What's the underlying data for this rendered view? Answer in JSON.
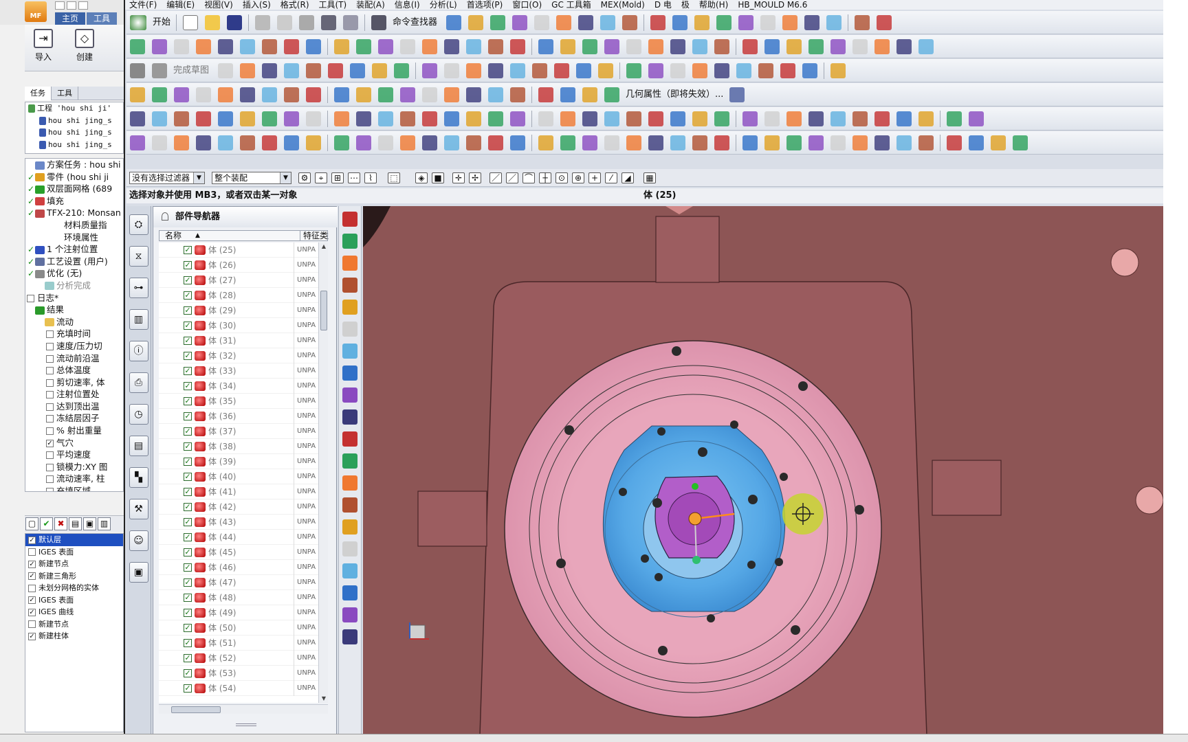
{
  "left_app": {
    "logo": "MF",
    "ribbon_tabs": [
      "主页",
      "工具"
    ],
    "ribbon_buttons": [
      "导入",
      "创建"
    ],
    "pane_tabs": [
      "任务",
      "工具"
    ],
    "project_tree": [
      {
        "label": "工程 'hou shi ji'",
        "level": 0
      },
      {
        "label": "hou shi jing_s",
        "level": 1
      },
      {
        "label": "hou shi jing_s",
        "level": 1
      },
      {
        "label": "hou shi jing_s",
        "level": 1
      }
    ],
    "study_tree": [
      {
        "label": "方案任务 : hou shi",
        "check": "",
        "color": "#6b88c8",
        "indent": 0
      },
      {
        "label": "零件 (hou shi ji",
        "check": "✓",
        "color": "#e0a020",
        "indent": 0
      },
      {
        "label": "双层面网格 (689",
        "check": "✓",
        "color": "#2aa02a",
        "indent": 0
      },
      {
        "label": "填充",
        "check": "✓",
        "color": "#d04040",
        "indent": 0
      },
      {
        "label": "TFX-210: Monsan",
        "check": "✓",
        "color": "#c04848",
        "indent": 0
      },
      {
        "label": "材料质量指",
        "check": "",
        "color": "",
        "indent": 3
      },
      {
        "label": "环境属性",
        "check": "",
        "color": "",
        "indent": 3
      },
      {
        "label": "1 个注射位置",
        "check": "✓",
        "color": "#3050c0",
        "indent": 0
      },
      {
        "label": "工艺设置 (用户)",
        "check": "✓",
        "color": "#6070a0",
        "indent": 0
      },
      {
        "label": "优化 (无)",
        "check": "✓",
        "color": "#8a8a8a",
        "indent": 0
      },
      {
        "label": "分析完成",
        "check": "",
        "color": "#9cc",
        "indent": 1,
        "grey": true
      },
      {
        "label": "日志*",
        "check": "☐",
        "color": "",
        "indent": 0
      },
      {
        "label": "结果",
        "check": "",
        "color": "#2a9a2a",
        "indent": 0
      },
      {
        "label": "流动",
        "check": "",
        "color": "#e8c050",
        "indent": 1
      },
      {
        "label": "充填时间",
        "check": "☐",
        "color": "",
        "indent": 2
      },
      {
        "label": "速度/压力切",
        "check": "☐",
        "color": "",
        "indent": 2
      },
      {
        "label": "流动前沿温",
        "check": "☐",
        "color": "",
        "indent": 2
      },
      {
        "label": "总体温度",
        "check": "☐",
        "color": "",
        "indent": 2
      },
      {
        "label": "剪切速率, 体",
        "check": "☐",
        "color": "",
        "indent": 2
      },
      {
        "label": "注射位置处",
        "check": "☐",
        "color": "",
        "indent": 2
      },
      {
        "label": "达到顶出温",
        "check": "☐",
        "color": "",
        "indent": 2
      },
      {
        "label": "冻结层因子",
        "check": "☐",
        "color": "",
        "indent": 2
      },
      {
        "label": "% 射出重量",
        "check": "☐",
        "color": "",
        "indent": 2
      },
      {
        "label": "气穴",
        "check": "☑",
        "color": "",
        "indent": 2
      },
      {
        "label": "平均速度",
        "check": "☐",
        "color": "",
        "indent": 2
      },
      {
        "label": "锁模力:XY 图",
        "check": "☐",
        "color": "",
        "indent": 2
      },
      {
        "label": "流动速率, 柱",
        "check": "☐",
        "color": "",
        "indent": 2
      },
      {
        "label": "充填区域",
        "check": "☐",
        "color": "",
        "indent": 2
      }
    ],
    "layers": [
      {
        "label": "默认层",
        "checked": true,
        "selected": true
      },
      {
        "label": "IGES 表面",
        "checked": false
      },
      {
        "label": "新建节点",
        "checked": true
      },
      {
        "label": "新建三角形",
        "checked": true
      },
      {
        "label": "未划分网格的实体",
        "checked": false
      },
      {
        "label": "IGES 表面",
        "checked": true
      },
      {
        "label": "IGES 曲线",
        "checked": true
      },
      {
        "label": "新建节点",
        "checked": false
      },
      {
        "label": "新建柱体",
        "checked": true
      }
    ]
  },
  "nx": {
    "menu": [
      "文件(F)",
      "编辑(E)",
      "视图(V)",
      "插入(S)",
      "格式(R)",
      "工具(T)",
      "装配(A)",
      "信息(I)",
      "分析(L)",
      "首选项(P)",
      "窗口(O)",
      "GC 工具箱",
      "MEX(Mold)",
      "D 电",
      "极",
      "帮助(H)",
      "HB_MOULD M6.6"
    ],
    "toolbar": {
      "start_label": "开始",
      "command_finder": "命令查找器",
      "finish_sketch": "完成草图",
      "geometry_properties": "几何属性（即将失效）..."
    },
    "filter": {
      "selection_filter": "没有选择过滤器",
      "scope": "整个装配"
    },
    "status": {
      "prompt": "选择对象并使用 MB3，或者双击某一对象",
      "selection": "体 (25)"
    },
    "part_navigator": {
      "title": "部件导航器",
      "col_name": "名称",
      "col_feature": "特征类型",
      "rows": [
        {
          "name": "体 (25)",
          "type": "UNPA"
        },
        {
          "name": "体 (26)",
          "type": "UNPA"
        },
        {
          "name": "体 (27)",
          "type": "UNPA"
        },
        {
          "name": "体 (28)",
          "type": "UNPA"
        },
        {
          "name": "体 (29)",
          "type": "UNPA"
        },
        {
          "name": "体 (30)",
          "type": "UNPA"
        },
        {
          "name": "体 (31)",
          "type": "UNPA"
        },
        {
          "name": "体 (32)",
          "type": "UNPA"
        },
        {
          "name": "体 (33)",
          "type": "UNPA"
        },
        {
          "name": "体 (34)",
          "type": "UNPA"
        },
        {
          "name": "体 (35)",
          "type": "UNPA"
        },
        {
          "name": "体 (36)",
          "type": "UNPA"
        },
        {
          "name": "体 (37)",
          "type": "UNPA"
        },
        {
          "name": "体 (38)",
          "type": "UNPA"
        },
        {
          "name": "体 (39)",
          "type": "UNPA"
        },
        {
          "name": "体 (40)",
          "type": "UNPA"
        },
        {
          "name": "体 (41)",
          "type": "UNPA"
        },
        {
          "name": "体 (42)",
          "type": "UNPA"
        },
        {
          "name": "体 (43)",
          "type": "UNPA"
        },
        {
          "name": "体 (44)",
          "type": "UNPA"
        },
        {
          "name": "体 (45)",
          "type": "UNPA"
        },
        {
          "name": "体 (46)",
          "type": "UNPA"
        },
        {
          "name": "体 (47)",
          "type": "UNPA"
        },
        {
          "name": "体 (48)",
          "type": "UNPA"
        },
        {
          "name": "体 (49)",
          "type": "UNPA"
        },
        {
          "name": "体 (50)",
          "type": "UNPA"
        },
        {
          "name": "体 (51)",
          "type": "UNPA"
        },
        {
          "name": "体 (52)",
          "type": "UNPA"
        },
        {
          "name": "体 (53)",
          "type": "UNPA"
        },
        {
          "name": "体 (54)",
          "type": "UNPA"
        }
      ]
    }
  },
  "colors": {
    "viewport_background": "#8d5555",
    "plate": "#9a5b5e",
    "pink_ring": "#e3a2b3",
    "blue_face": "#5aaee8",
    "purple_center": "#b05cc8",
    "selected_layer": "#1e4fc0"
  }
}
